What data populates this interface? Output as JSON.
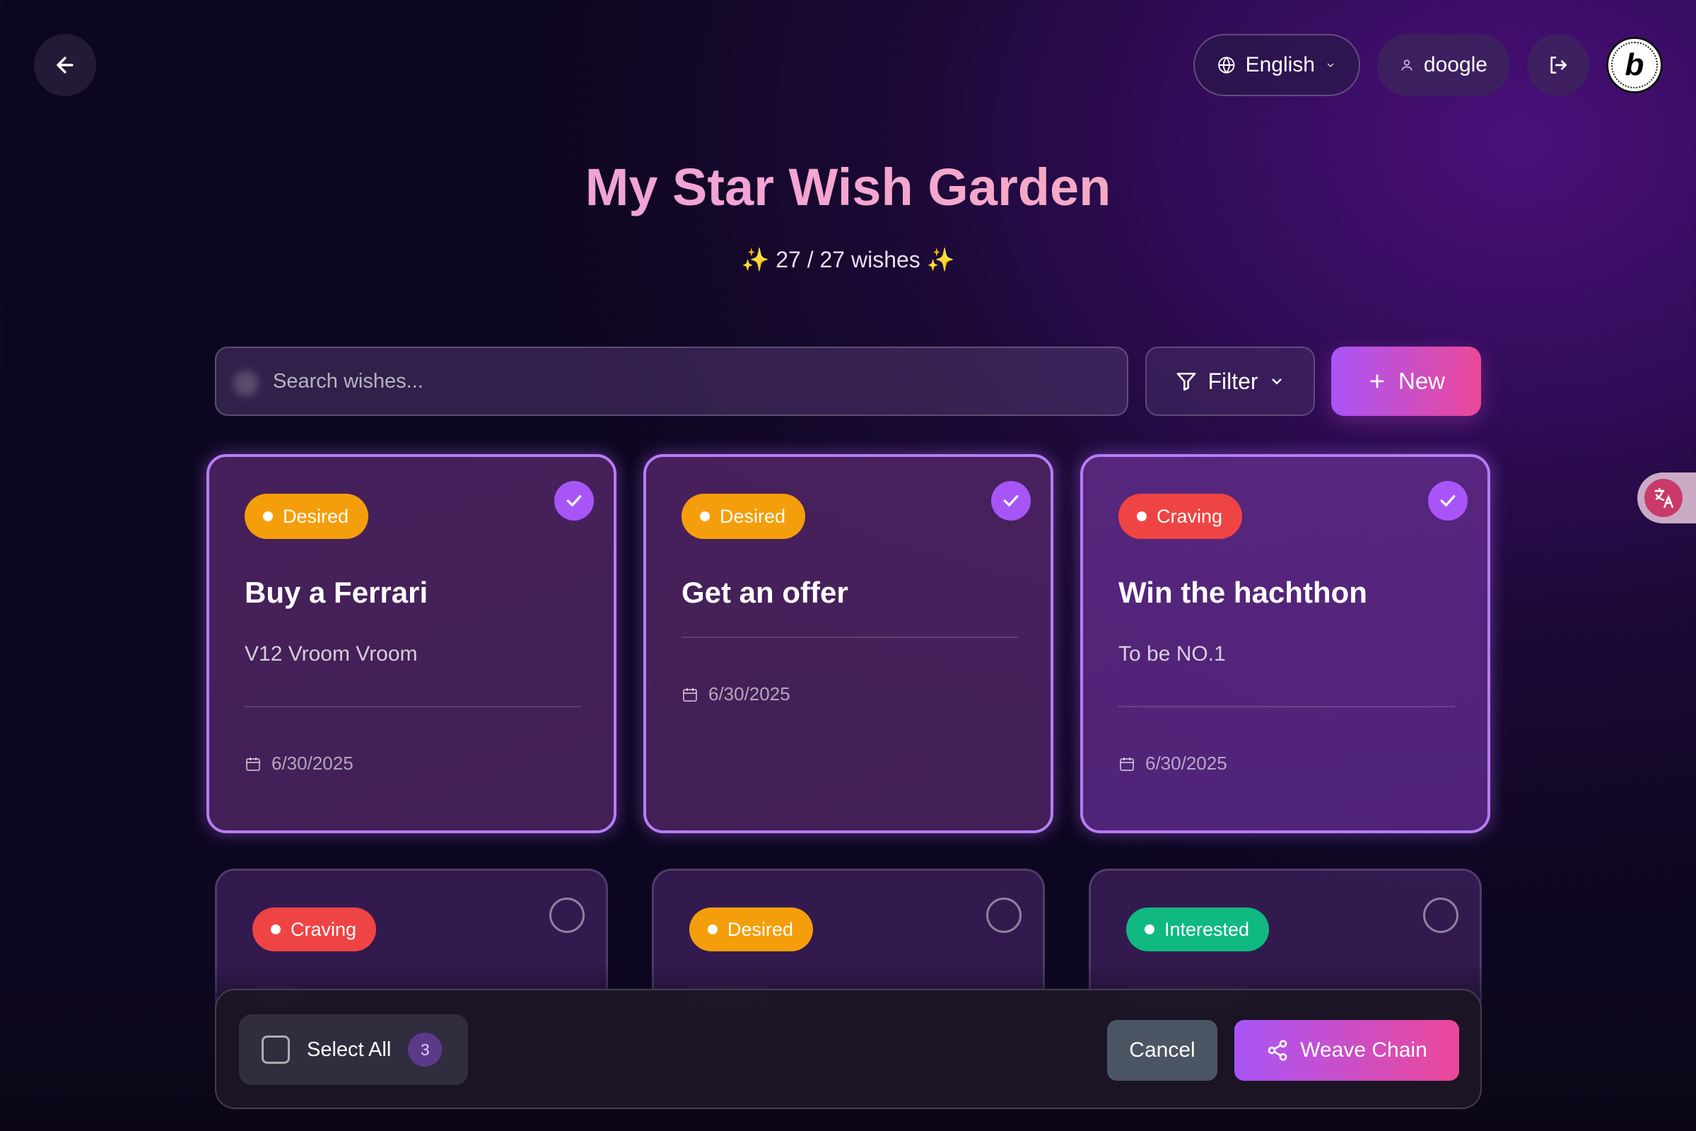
{
  "header": {
    "language": "English",
    "user": "doogle"
  },
  "page": {
    "title": "My Star Wish Garden",
    "subtitle": "✨ 27 / 27 wishes ✨"
  },
  "toolbar": {
    "search_placeholder": "Search wishes...",
    "filter_label": "Filter",
    "new_label": "New"
  },
  "cards": [
    {
      "badge": "Desired",
      "title": "Buy a Ferrari",
      "desc": "V12 Vroom Vroom",
      "date": "6/30/2025",
      "selected": true
    },
    {
      "badge": "Desired",
      "title": "Get an offer",
      "desc": "",
      "date": "6/30/2025",
      "selected": true
    },
    {
      "badge": "Craving",
      "title": "Win the hachthon",
      "desc": "To be NO.1",
      "date": "6/30/2025",
      "selected": true
    },
    {
      "badge": "Craving",
      "selected": false
    },
    {
      "badge": "Desired",
      "selected": false
    },
    {
      "badge": "Interested",
      "selected": false
    }
  ],
  "bottom_bar": {
    "select_all_label": "Select All",
    "selected_count": "3",
    "cancel_label": "Cancel",
    "weave_label": "Weave Chain"
  },
  "colors": {
    "desired": "#f59e0b",
    "craving": "#ef4444",
    "interested": "#10b981",
    "accent": "#a855f7",
    "accent_pink": "#ec4899"
  }
}
